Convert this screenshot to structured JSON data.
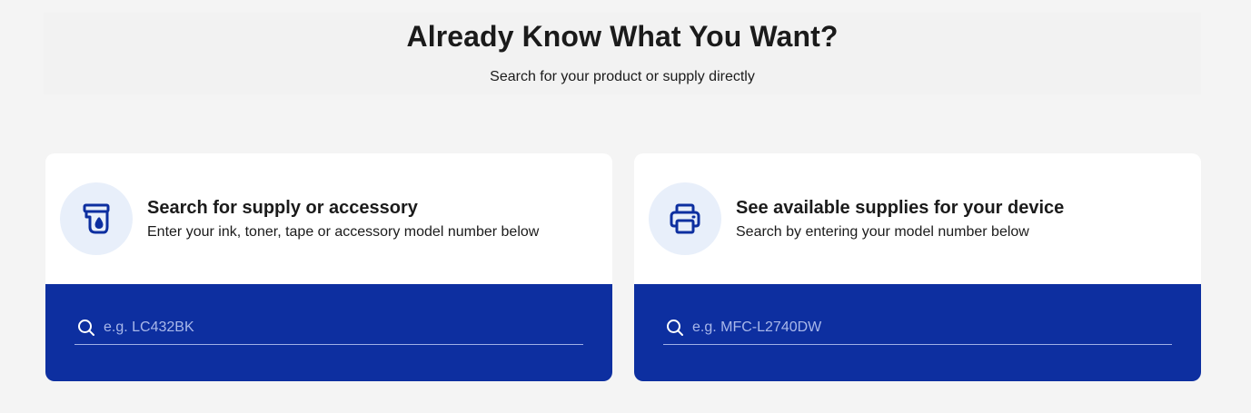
{
  "hero": {
    "title": "Already Know What You Want?",
    "subtitle": "Search for your product or supply directly"
  },
  "cards": [
    {
      "icon": "ink-cartridge-icon",
      "title": "Search for supply or accessory",
      "subtitle": "Enter your ink, toner, tape or accessory model number below",
      "search": {
        "placeholder": "e.g. LC432BK",
        "value": ""
      }
    },
    {
      "icon": "printer-icon",
      "title": "See available supplies for your device",
      "subtitle": "Search by entering your model number below",
      "search": {
        "placeholder": "e.g. MFC-L2740DW",
        "value": ""
      }
    }
  ],
  "colors": {
    "page_background": "#f4f4f4",
    "card_background": "#ffffff",
    "search_panel": "#0d2fa0",
    "icon_circle": "#e8effa",
    "icon_stroke": "#0d2fa0",
    "placeholder_text": "#a9b8ea"
  }
}
